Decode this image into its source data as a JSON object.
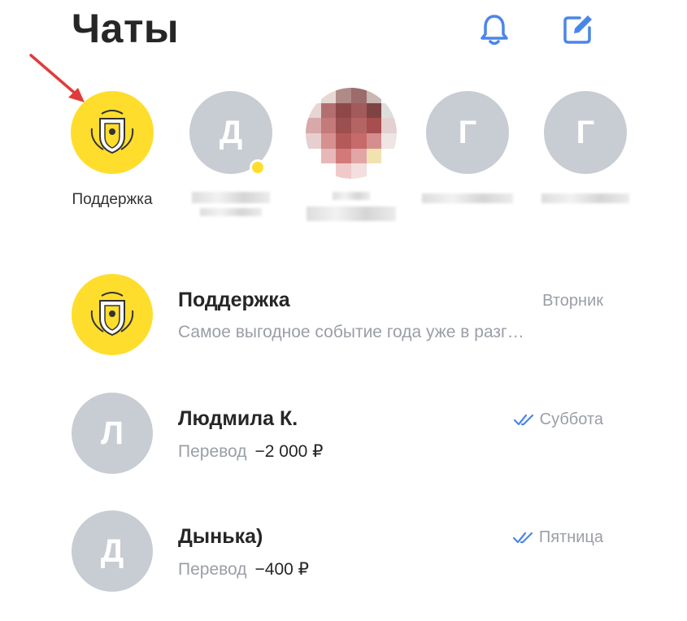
{
  "header": {
    "title": "Чаты",
    "icons": [
      "bell-icon",
      "compose-icon"
    ],
    "accent_color": "#4a86e8"
  },
  "stories": [
    {
      "label": "Поддержка",
      "avatar": "tinkoff-logo",
      "color": "#ffdd2d"
    },
    {
      "letter": "Д",
      "label": "",
      "unread": true
    },
    {
      "label": "",
      "avatar": "photo"
    },
    {
      "letter": "Г",
      "label": ""
    },
    {
      "letter": "Г",
      "label": ""
    }
  ],
  "chats": [
    {
      "name": "Поддержка",
      "date": "Вторник",
      "preview": "Самое выгодное событие года уже в разг…",
      "avatar": "tinkoff-logo"
    },
    {
      "name": "Людмила К.",
      "date": "Суббота",
      "preview_label": "Перевод",
      "amount": "−2 000 ₽",
      "letter": "Л",
      "read": true
    },
    {
      "name": "Дынька)",
      "date": "Пятница",
      "preview_label": "Перевод",
      "amount": "−400 ₽",
      "letter": "Д",
      "read": true
    }
  ]
}
